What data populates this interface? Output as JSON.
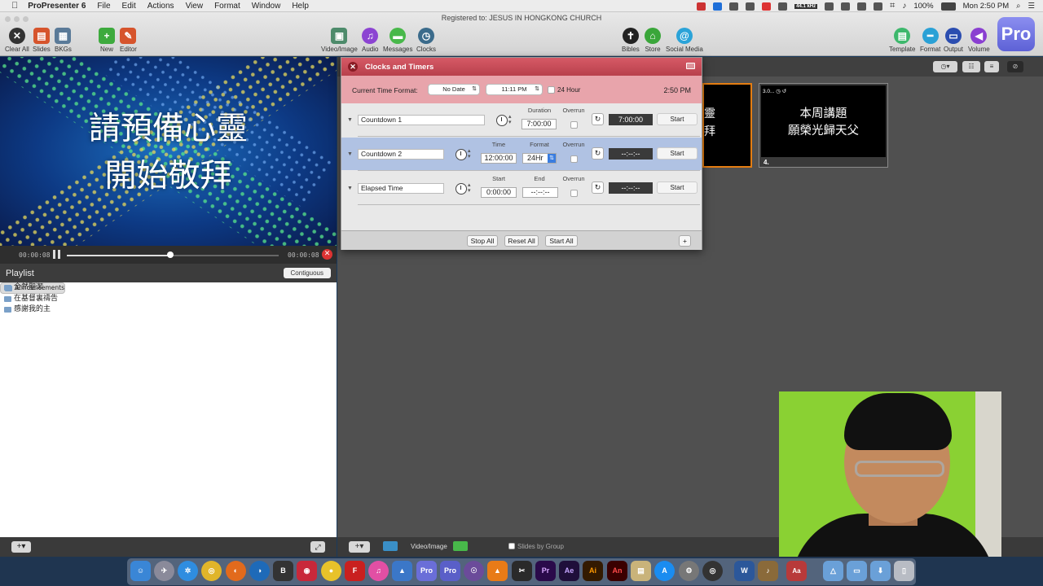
{
  "menubar": {
    "app_name": "ProPresenter 6",
    "items": [
      "File",
      "Edit",
      "Actions",
      "View",
      "Format",
      "Window",
      "Help"
    ],
    "sample_rate": "44.1 kHz",
    "battery": "100%",
    "clock": "Mon 2:50 PM"
  },
  "toolbar": {
    "registered": "Registered to: JESUS IN HONGKONG CHURCH",
    "clear_all": "Clear All",
    "slides": "Slides",
    "bkgs": "BKGs",
    "new": "New",
    "editor": "Editor",
    "video_image": "Video/Image",
    "audio": "Audio",
    "messages": "Messages",
    "clocks": "Clocks",
    "bibles": "Bibles",
    "store": "Store",
    "social_media": "Social Media",
    "template": "Template",
    "format": "Format",
    "output": "Output",
    "volume": "Volume",
    "logo": "Pro"
  },
  "preview": {
    "line1": "請預備心靈",
    "line2": "開始敬拜",
    "time_elapsed": "00:00:08",
    "time_remaining": "00:00:08",
    "progress": 0.49
  },
  "playlist": {
    "title": "Playlist",
    "mode_button": "Contiguous",
    "items": [
      "Announcements",
      "全然聖潔",
      "在基督裏禱告",
      "感謝我的主"
    ]
  },
  "clocks_timers": {
    "title": "Clocks and Timers",
    "current_time_format_label": "Current Time Format:",
    "date_format": "No Date",
    "time_format": "11:11 PM",
    "hour24_label": "24 Hour",
    "current_time": "2:50 PM",
    "timers": [
      {
        "name": "Countdown 1",
        "col1_label": "Duration",
        "col1_value": "7:00:00",
        "col2_label": "",
        "col2_value": "",
        "overrun_label": "Overrun",
        "display": "7:00:00",
        "start_label": "Start"
      },
      {
        "name": "Countdown 2",
        "col1_label": "Time",
        "col1_value": "12:00:00",
        "col2_label": "Format",
        "col2_value": "24Hr",
        "overrun_label": "Overrun",
        "display": "--:--:--",
        "start_label": "Start"
      },
      {
        "name": "Elapsed Time",
        "col1_label": "Start",
        "col1_value": "0:00:00",
        "col2_label": "End",
        "col2_value": "--:--:--",
        "overrun_label": "Overrun",
        "display": "--:--:--",
        "start_label": "Start"
      }
    ],
    "stop_all": "Stop All",
    "reset_all": "Reset All",
    "start_all": "Start All",
    "add": "+"
  },
  "slides": {
    "slide3_text": [
      "靈",
      "拜"
    ],
    "slide4_meta": "3.0...",
    "slide4_lines": [
      "本周講題",
      "願榮光歸天父"
    ],
    "slide4_number": "4."
  },
  "bottom_bar": {
    "video_image": "Video/Image",
    "slides_by_group": "Slides by Group"
  },
  "dock": {
    "apps": [
      "finder-icon",
      "launchpad-icon",
      "safari-icon",
      "chrome-icon",
      "firefox-icon",
      "edge-icon",
      "bbedit-icon",
      "photo-booth-icon",
      "cyberduck-icon",
      "filezilla-icon",
      "itunes-icon",
      "keynote-icon",
      "propresenter-icon",
      "propresenter2-icon",
      "alfred-icon",
      "vlc-icon",
      "final-cut-icon",
      "premiere-icon",
      "after-effects-icon",
      "illustrator-icon",
      "animate-icon",
      "notes-icon",
      "app-store-icon",
      "system-preferences-icon",
      "obs-icon",
      "word-icon",
      "font-book-icon",
      "downloads-icon",
      "trash-icon"
    ],
    "labels": {
      "pro": "Pro",
      "pr": "Pr",
      "ae": "Ae",
      "ai": "Ai",
      "an": "An",
      "w": "W"
    }
  },
  "colors": {
    "accent_red": "#c4505b",
    "selection_blue": "#b0c2e3",
    "slide_border_orange": "#e47d12"
  }
}
